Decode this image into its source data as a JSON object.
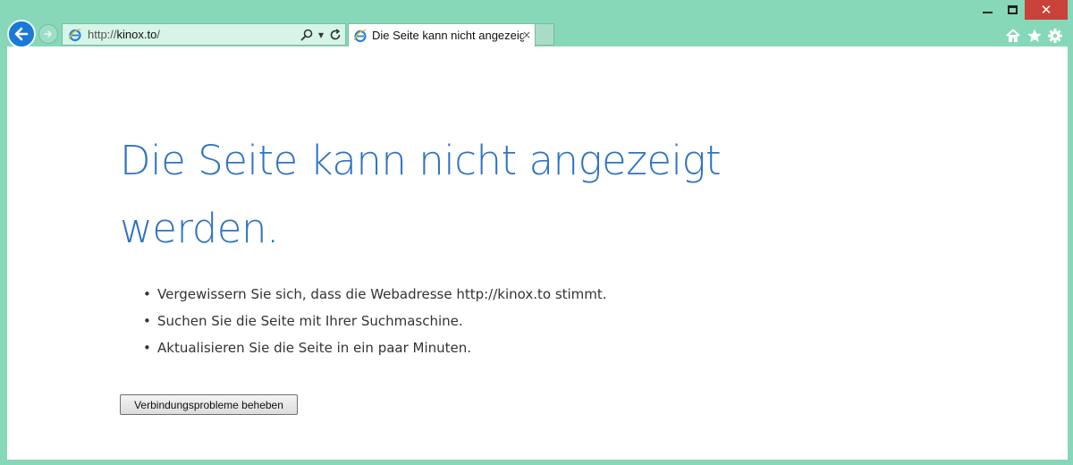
{
  "window": {
    "minimize_icon": "minimize-icon",
    "maximize_icon": "maximize-icon",
    "close_icon": "close-icon",
    "close_glyph": "✕"
  },
  "navigation": {
    "back_icon": "back-arrow-icon",
    "forward_icon": "forward-arrow-icon"
  },
  "address_bar": {
    "prefix": "http://",
    "domain": "kinox.to",
    "suffix": "/",
    "search_icon": "search-icon",
    "dropdown_glyph": "▾",
    "refresh_icon": "refresh-icon"
  },
  "tab": {
    "title": "Die Seite kann nicht angezeig...",
    "close_glyph": "×"
  },
  "toolbar": {
    "home_icon": "home-icon",
    "favorites_icon": "star-icon",
    "tools_icon": "gear-icon"
  },
  "error_page": {
    "headline": "Die Seite kann nicht angezeigt werden.",
    "tips": [
      "Vergewissern Sie sich, dass die Webadresse http://kinox.to stimmt.",
      "Suchen Sie die Seite mit Ihrer Suchmaschine.",
      "Aktualisieren Sie die Seite in ein paar Minuten."
    ],
    "fix_button_label": "Verbindungsprobleme beheben"
  },
  "colors": {
    "chrome_background": "#86d8b8",
    "accent_blue": "#2f73c4",
    "close_red": "#c9423a"
  }
}
